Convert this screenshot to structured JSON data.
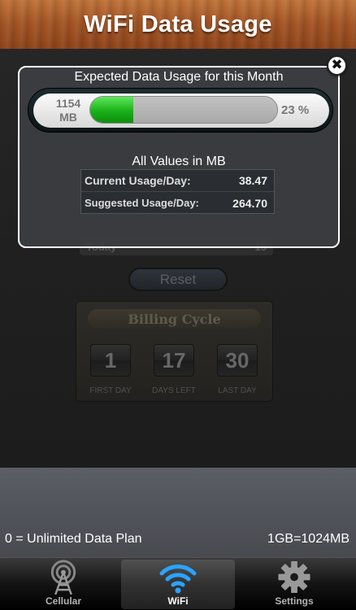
{
  "header": {
    "title": "WiFi Data Usage"
  },
  "modal": {
    "title": "Expected Data Usage for this Month",
    "total_value": "1154",
    "total_unit": "MB",
    "percent_label": "23 %",
    "percent": 23,
    "units_label": "All Values in MB",
    "stats": [
      {
        "label": "Current Usage/Day:",
        "value": "38.47"
      },
      {
        "label": "Suggested Usage/Day:",
        "value": "264.70"
      }
    ],
    "close_glyph": "✖"
  },
  "background": {
    "today_label": "Today",
    "today_value": "15",
    "reset_label": "Reset",
    "billing_title": "Billing Cycle",
    "billing": [
      {
        "value": "1",
        "label": "FIRST DAY"
      },
      {
        "value": "17",
        "label": "DAYS LEFT"
      },
      {
        "value": "30",
        "label": "LAST DAY"
      }
    ]
  },
  "footer": {
    "plan_note": "0 = Unlimited Data Plan",
    "gb_note": "1GB=1024MB"
  },
  "tabs": [
    {
      "label": "Cellular",
      "icon": "cell-tower-icon",
      "active": false
    },
    {
      "label": "WiFi",
      "icon": "wifi-icon",
      "active": true
    },
    {
      "label": "Settings",
      "icon": "gear-icon",
      "active": false
    }
  ],
  "colors": {
    "header_wood": "#a55626",
    "progress_green": "#19b119",
    "wifi_blue": "#2aa3ff"
  }
}
